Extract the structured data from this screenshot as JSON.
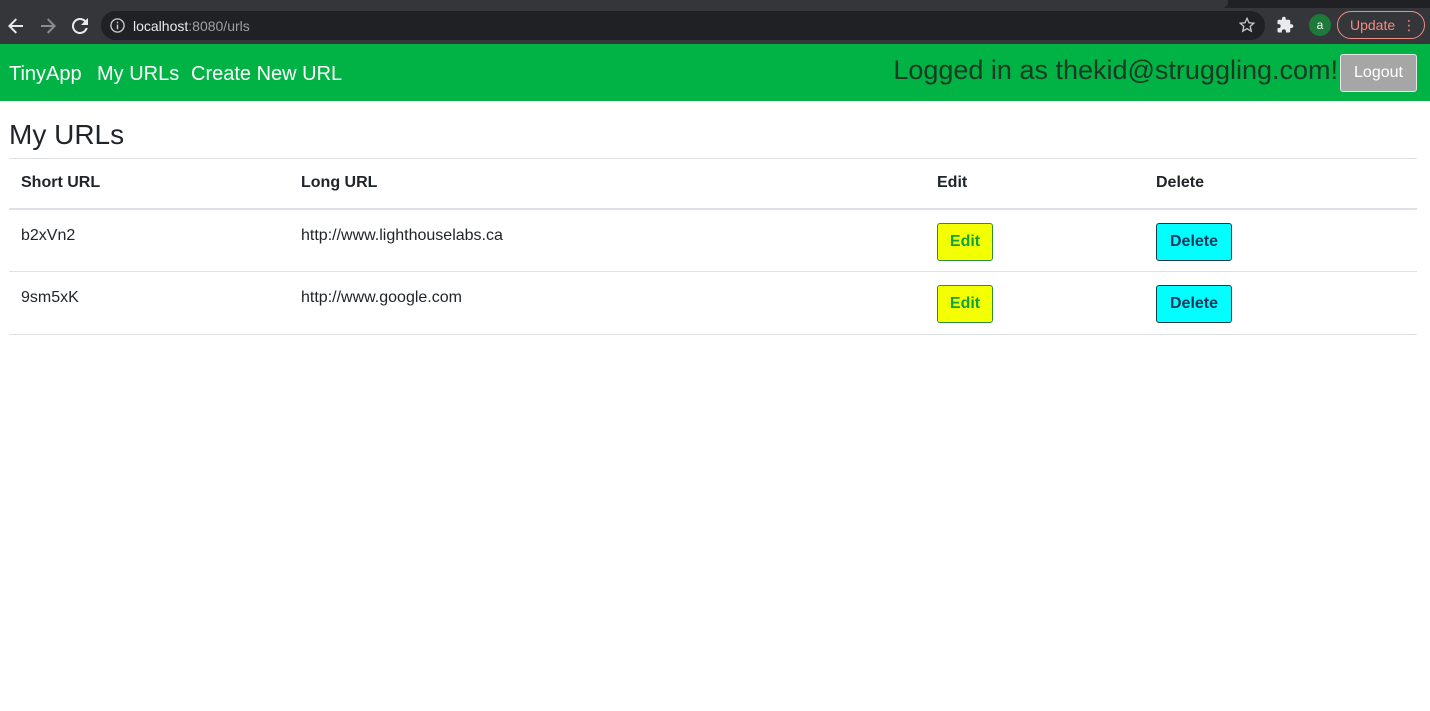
{
  "browser": {
    "url_host": "localhost",
    "url_path": ":8080/urls",
    "avatar_letter": "a",
    "update_label": "Update",
    "icons": [
      "back-arrow-icon",
      "forward-arrow-icon",
      "reload-icon",
      "info-icon",
      "star-icon",
      "puzzle-icon",
      "more-vert-icon"
    ]
  },
  "navbar": {
    "brand": "TinyApp",
    "my_urls": "My URLs",
    "create_new": "Create New URL",
    "logged_in_text": "Logged in as thekid@struggling.com!",
    "logout_label": "Logout",
    "bg_color": "#00b344"
  },
  "main": {
    "title": "My URLs",
    "table": {
      "headers": [
        "Short URL",
        "Long URL",
        "Edit",
        "Delete"
      ],
      "rows": [
        {
          "short": "b2xVn2",
          "long": "http://www.lighthouselabs.ca",
          "edit_label": "Edit",
          "delete_label": "Delete"
        },
        {
          "short": "9sm5xK",
          "long": "http://www.google.com",
          "edit_label": "Edit",
          "delete_label": "Delete"
        }
      ]
    },
    "colors": {
      "edit_bg": "#f4ff00",
      "delete_bg": "#00ffff"
    }
  }
}
